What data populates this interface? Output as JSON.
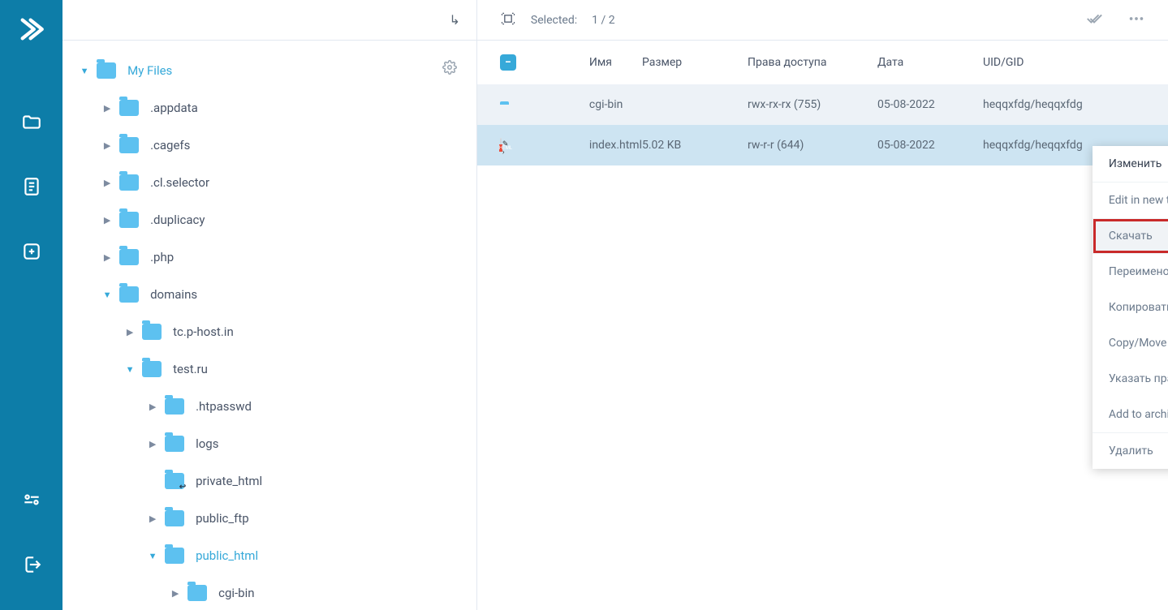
{
  "toolbar": {
    "selected_label": "Selected:",
    "selected_count": "1 / 2"
  },
  "tree": {
    "root_label": "My Files",
    "items": [
      {
        "label": ".appdata",
        "depth": 1,
        "open": false
      },
      {
        "label": ".cagefs",
        "depth": 1,
        "open": false
      },
      {
        "label": ".cl.selector",
        "depth": 1,
        "open": false
      },
      {
        "label": ".duplicacy",
        "depth": 1,
        "open": false
      },
      {
        "label": ".php",
        "depth": 1,
        "open": false
      },
      {
        "label": "domains",
        "depth": 1,
        "open": true
      },
      {
        "label": "tc.p-host.in",
        "depth": 2,
        "open": false
      },
      {
        "label": "test.ru",
        "depth": 2,
        "open": true
      },
      {
        "label": ".htpasswd",
        "depth": 3,
        "open": false
      },
      {
        "label": "logs",
        "depth": 3,
        "open": false
      },
      {
        "label": "private_html",
        "depth": 3,
        "open": false,
        "link": true,
        "no_caret": true
      },
      {
        "label": "public_ftp",
        "depth": 3,
        "open": false
      },
      {
        "label": "public_html",
        "depth": 3,
        "open": true,
        "active": true
      },
      {
        "label": "cgi-bin",
        "depth": 4,
        "open": false
      }
    ]
  },
  "columns": {
    "name": "Имя",
    "size": "Размер",
    "perms": "Права доступа",
    "date": "Дата",
    "owner": "UID/GID"
  },
  "rows": [
    {
      "icon": "folder",
      "name": "cgi-bin",
      "size": "",
      "perms": "rwx-rx-rx (755)",
      "date": "05-08-2022",
      "owner": "heqqxfdg/heqqxfdg",
      "selected": false,
      "stripe": true
    },
    {
      "icon": "html",
      "name": "index.html",
      "size": "5.02 KB",
      "perms": "rw-r-r (644)",
      "date": "05-08-2022",
      "owner": "heqqxfdg/heqqxfdg",
      "selected": true,
      "stripe": false
    }
  ],
  "ctx": {
    "items": [
      {
        "label": "Изменить",
        "top": true
      },
      {
        "label": "Edit in new tab"
      },
      {
        "label": "Скачать",
        "highlight": true,
        "boxed": true
      },
      {
        "label": "Переименовать"
      },
      {
        "label": "Копировать"
      },
      {
        "label": "Copy/Move to..."
      },
      {
        "label": "Указать права доступа"
      },
      {
        "label": "Add to archive"
      },
      {
        "label": "Удалить",
        "sep_above": true
      }
    ]
  }
}
